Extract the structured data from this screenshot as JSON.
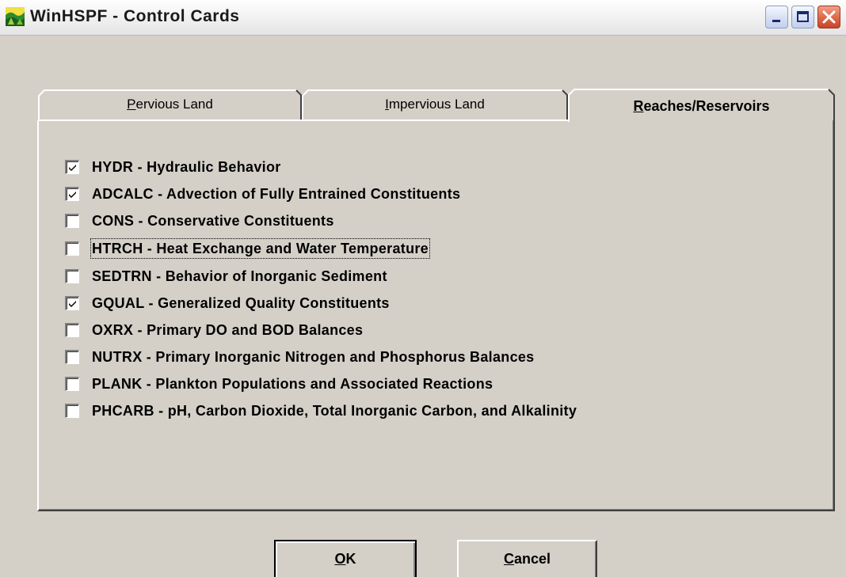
{
  "window": {
    "title": "WinHSPF - Control Cards",
    "icon": "winhspf-app-icon",
    "controls": {
      "minimize": "minimize-icon",
      "maximize": "maximize-icon",
      "close": "close-icon"
    }
  },
  "tabs": [
    {
      "accel": "P",
      "rest": "ervious Land",
      "selected": false
    },
    {
      "accel": "I",
      "rest": "mpervious Land",
      "selected": false
    },
    {
      "accel": "R",
      "rest": "eaches/Reservoirs",
      "selected": true
    }
  ],
  "options": [
    {
      "label": "HYDR - Hydraulic Behavior",
      "checked": true
    },
    {
      "label": "ADCALC - Advection of Fully Entrained Constituents",
      "checked": true
    },
    {
      "label": "CONS - Conservative Constituents",
      "checked": false
    },
    {
      "label": "HTRCH - Heat Exchange and Water Temperature",
      "checked": false,
      "focused": true
    },
    {
      "label": "SEDTRN - Behavior of Inorganic Sediment",
      "checked": false
    },
    {
      "label": "GQUAL - Generalized Quality Constituents",
      "checked": true
    },
    {
      "label": "OXRX - Primary DO and BOD Balances",
      "checked": false
    },
    {
      "label": "NUTRX - Primary Inorganic Nitrogen and Phosphorus Balances",
      "checked": false
    },
    {
      "label": "PLANK - Plankton Populations and Associated Reactions",
      "checked": false
    },
    {
      "label": "PHCARB - pH, Carbon Dioxide, Total Inorganic Carbon, and Alkalinity",
      "checked": false
    }
  ],
  "buttons": {
    "ok": {
      "accel": "O",
      "rest": "K"
    },
    "cancel": {
      "accel": "C",
      "rest": "ancel"
    }
  },
  "colors": {
    "face": "#d4d0c8",
    "highlight": "#ffffff",
    "shadow": "#808080",
    "dark_shadow": "#404040",
    "close_red": "#e06b4a"
  }
}
